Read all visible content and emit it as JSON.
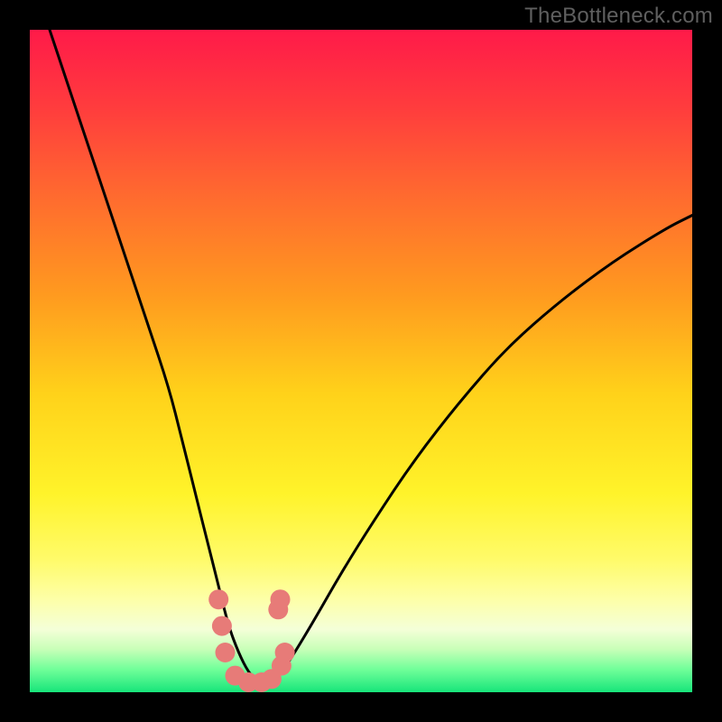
{
  "watermark": "TheBottleneck.com",
  "colors": {
    "frame": "#000000",
    "curve": "#000000",
    "marker": "#e77b78",
    "gradient_stops": [
      {
        "offset": 0.0,
        "color": "#ff1a49"
      },
      {
        "offset": 0.12,
        "color": "#ff3d3d"
      },
      {
        "offset": 0.25,
        "color": "#ff6a2f"
      },
      {
        "offset": 0.4,
        "color": "#ff9a1f"
      },
      {
        "offset": 0.55,
        "color": "#ffd21a"
      },
      {
        "offset": 0.7,
        "color": "#fff32a"
      },
      {
        "offset": 0.8,
        "color": "#fffb6a"
      },
      {
        "offset": 0.86,
        "color": "#fdffa8"
      },
      {
        "offset": 0.905,
        "color": "#f4ffd8"
      },
      {
        "offset": 0.935,
        "color": "#c9ffb8"
      },
      {
        "offset": 0.965,
        "color": "#72ff9a"
      },
      {
        "offset": 1.0,
        "color": "#17e57a"
      }
    ]
  },
  "chart_data": {
    "type": "line",
    "title": "",
    "xlabel": "",
    "ylabel": "",
    "xlim": [
      0,
      100
    ],
    "ylim": [
      0,
      100
    ],
    "series": [
      {
        "name": "bottleneck-curve",
        "x": [
          3,
          6,
          9,
          12,
          15,
          18,
          21,
          23,
          25,
          27,
          28.5,
          30,
          31.5,
          33,
          34.5,
          36,
          38,
          40,
          43,
          47,
          52,
          58,
          65,
          72,
          80,
          88,
          96,
          100
        ],
        "y": [
          100,
          91,
          82,
          73,
          64,
          55,
          46,
          38,
          30,
          22,
          16,
          10,
          6,
          3,
          1.5,
          1.5,
          3,
          6,
          11,
          18,
          26,
          35,
          44,
          52,
          59,
          65,
          70,
          72
        ]
      }
    ],
    "markers": {
      "name": "highlight-dots",
      "points": [
        {
          "x": 28.5,
          "y": 14
        },
        {
          "x": 29.0,
          "y": 10
        },
        {
          "x": 29.5,
          "y": 6
        },
        {
          "x": 31.0,
          "y": 2.5
        },
        {
          "x": 33.0,
          "y": 1.5
        },
        {
          "x": 35.0,
          "y": 1.5
        },
        {
          "x": 36.5,
          "y": 2.0
        },
        {
          "x": 38.0,
          "y": 4.0
        },
        {
          "x": 38.5,
          "y": 6.0
        },
        {
          "x": 37.5,
          "y": 12.5
        },
        {
          "x": 37.8,
          "y": 14.0
        }
      ]
    }
  }
}
